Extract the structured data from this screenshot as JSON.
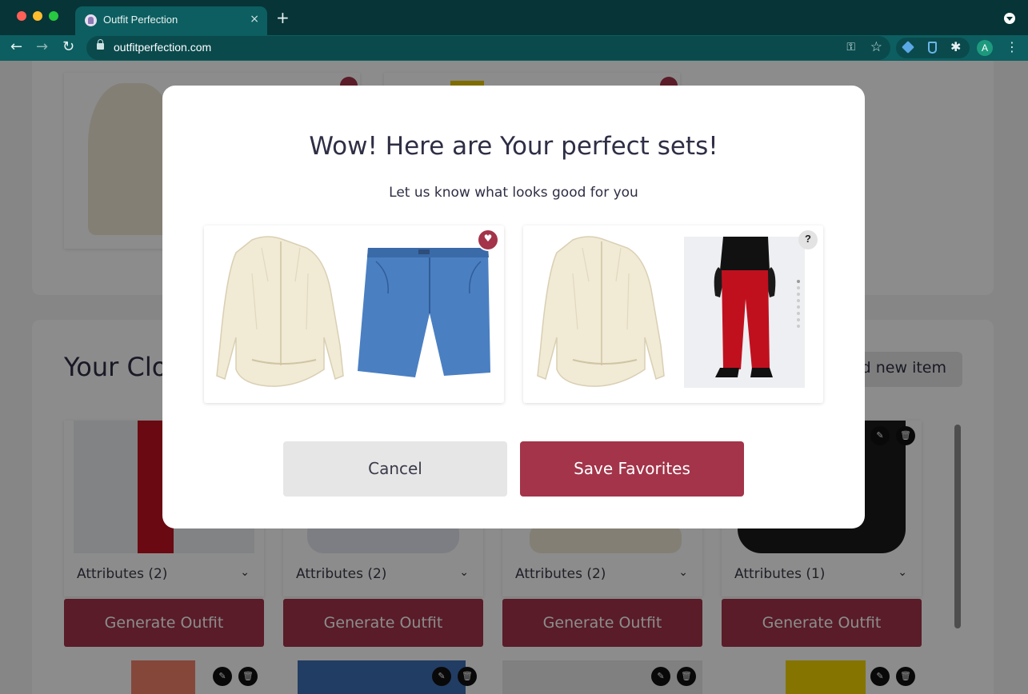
{
  "browser": {
    "tab_title": "Outfit Perfection",
    "tab_close": "×",
    "new_tab": "+",
    "url": "outfitperfection.com",
    "profile_initial": "A",
    "nav": {
      "back": "←",
      "forward": "→",
      "reload": "↻"
    },
    "icons": {
      "key": "⚿",
      "star": "☆",
      "extensions": "✱",
      "menu": "⋮"
    }
  },
  "page": {
    "closet_title": "Your Clo",
    "add_item_label": "d new item",
    "items": [
      {
        "attributes": "Attributes (2)",
        "button": "Generate Outfit"
      },
      {
        "attributes": "Attributes (2)",
        "button": "Generate Outfit"
      },
      {
        "attributes": "Attributes (2)",
        "button": "Generate Outfit"
      },
      {
        "attributes": "Attributes (1)",
        "button": "Generate Outfit"
      }
    ]
  },
  "modal": {
    "title": "Wow! Here are Your perfect sets!",
    "subtitle": "Let us know what looks good for you",
    "sets": [
      {
        "status": "favorite"
      },
      {
        "status": "unknown",
        "badge": "?"
      }
    ],
    "cancel_label": "Cancel",
    "save_label": "Save Favorites"
  },
  "colors": {
    "accent": "#a3344a",
    "title_text": "#2e2e45",
    "browser_chrome": "#0d5e60"
  }
}
